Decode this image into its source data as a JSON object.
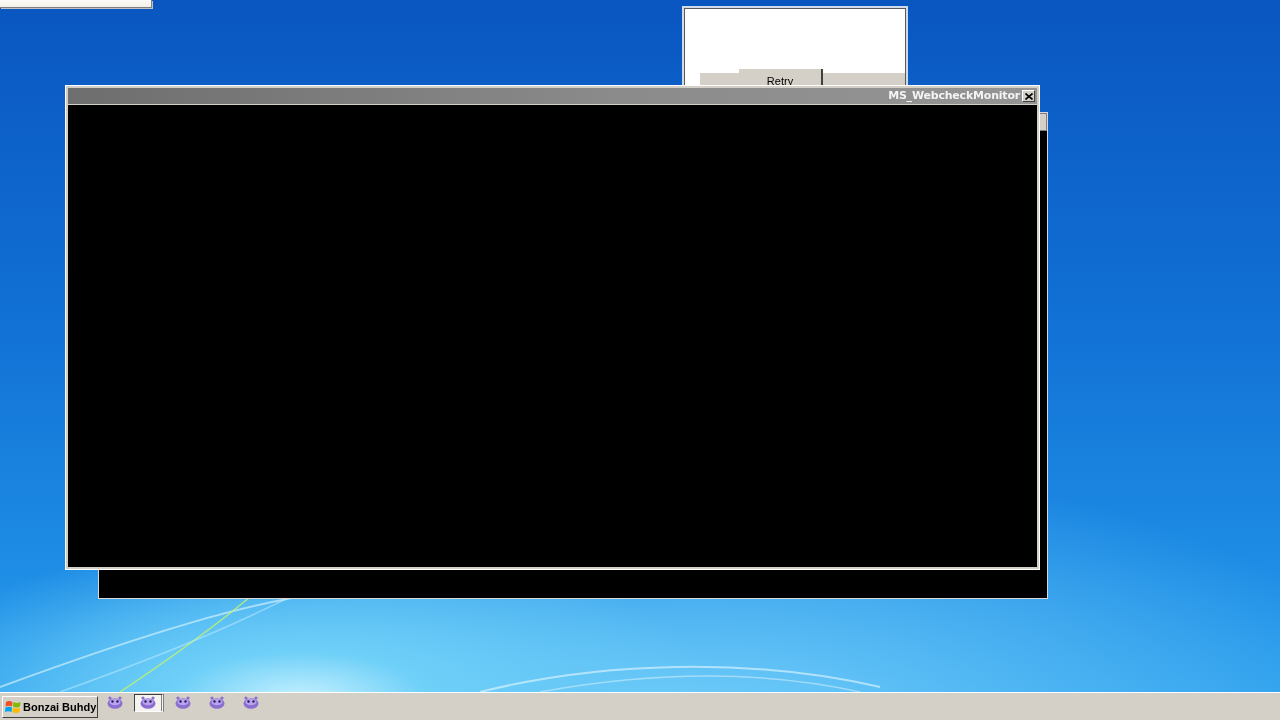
{
  "dialog": {
    "button": "Retry"
  },
  "window": {
    "title": "MS_WebcheckMonitor"
  },
  "taskbar": {
    "start_label": "Bonzai Buhdy",
    "buttons": [
      {
        "selected": false
      },
      {
        "selected": true
      },
      {
        "selected": false
      },
      {
        "selected": false
      },
      {
        "selected": false
      }
    ]
  }
}
